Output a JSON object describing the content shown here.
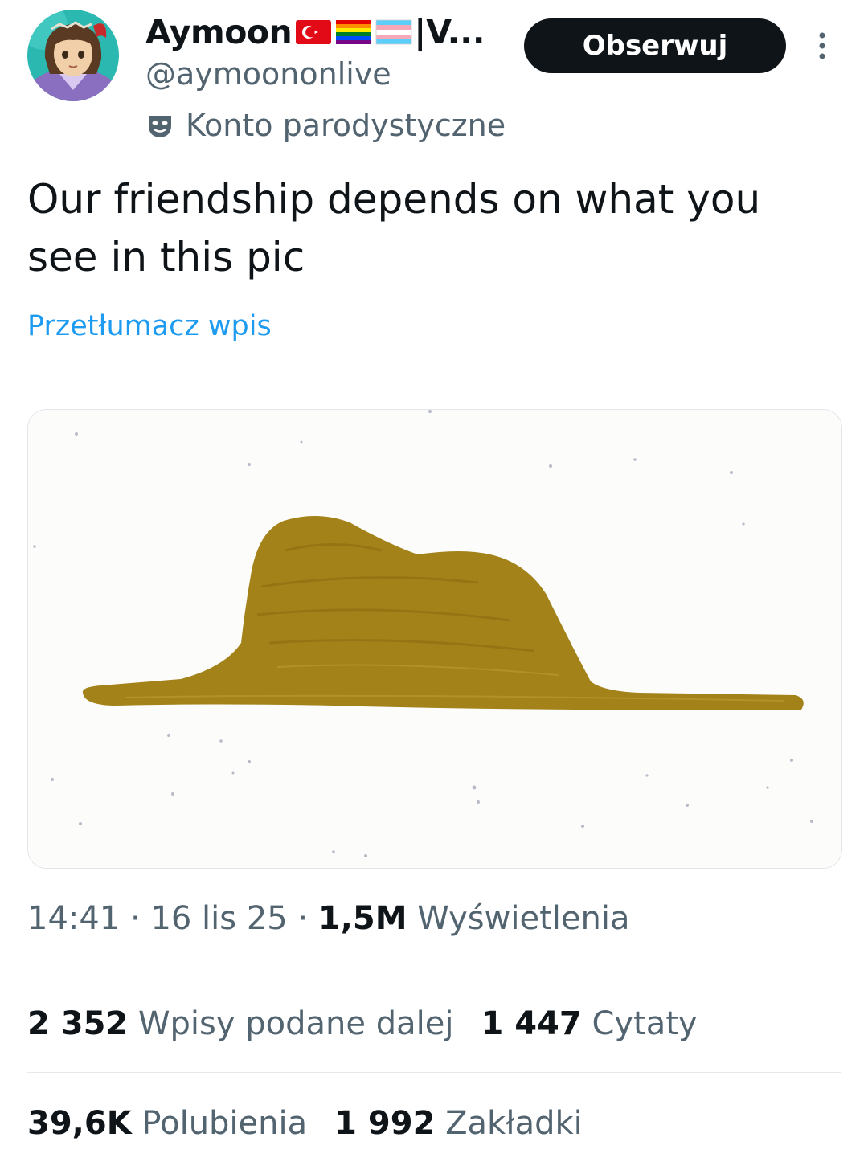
{
  "author": {
    "display_name": "Aymoon",
    "name_suffix": "|V...",
    "handle": "@aymoononlive",
    "parody_label": "Konto parodystyczne",
    "flags": [
      "turkey-flag-icon",
      "rainbow-flag-icon",
      "transgender-flag-icon"
    ]
  },
  "actions": {
    "follow_label": "Obserwuj",
    "more_icon": "more-vertical-icon"
  },
  "tweet": {
    "text": "Our friendship depends on what you see in this pic",
    "translate_label": "Przetłumacz wpis"
  },
  "meta": {
    "time": "14:41",
    "sep1": " · ",
    "date": "16 lis 25",
    "sep2": " · ",
    "views_count": "1,5M",
    "views_label": "Wyświetlenia"
  },
  "stats": {
    "reposts_count": "2 352",
    "reposts_label": "Wpisy podane dalej",
    "quotes_count": "1 447",
    "quotes_label": "Cytaty",
    "likes_count": "39,6K",
    "likes_label": "Polubienia",
    "bookmarks_count": "1 992",
    "bookmarks_label": "Zakładki"
  },
  "colors": {
    "accent": "#1d9bf0",
    "text": "#0f1419",
    "secondary": "#536471",
    "hat": "#a3821a"
  }
}
